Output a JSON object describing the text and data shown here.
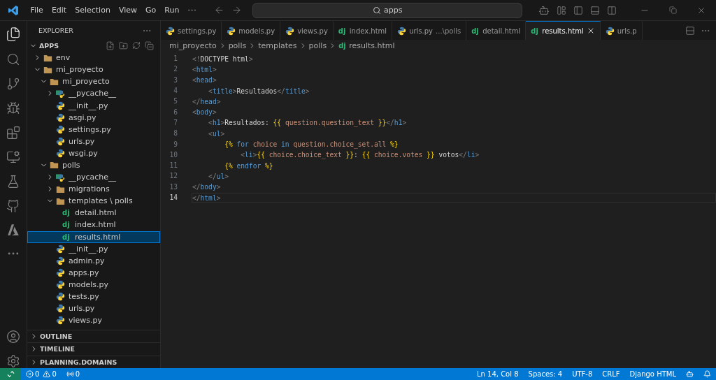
{
  "menu": [
    "File",
    "Edit",
    "Selection",
    "View",
    "Go",
    "Run"
  ],
  "search": {
    "value": "apps"
  },
  "explorer": {
    "title": "EXPLORER",
    "root": "APPS",
    "root_expanded": true,
    "tree": [
      {
        "name": "env",
        "kind": "folder",
        "expanded": false,
        "selected": false
      },
      {
        "name": "mi_proyecto",
        "kind": "folder",
        "expanded": true,
        "selected": false,
        "children": [
          {
            "name": "mi_proyecto",
            "kind": "folder",
            "expanded": true,
            "selected": false,
            "children": [
              {
                "name": "__pycache__",
                "kind": "pycache",
                "expanded": false,
                "selected": false
              },
              {
                "name": "__init__.py",
                "kind": "python",
                "selected": false
              },
              {
                "name": "asgi.py",
                "kind": "python",
                "selected": false
              },
              {
                "name": "settings.py",
                "kind": "python",
                "selected": false
              },
              {
                "name": "urls.py",
                "kind": "python",
                "selected": false
              },
              {
                "name": "wsgi.py",
                "kind": "python",
                "selected": false
              }
            ]
          },
          {
            "name": "polls",
            "kind": "folder",
            "expanded": true,
            "selected": false,
            "children": [
              {
                "name": "__pycache__",
                "kind": "pycache",
                "expanded": false,
                "selected": false
              },
              {
                "name": "migrations",
                "kind": "folder",
                "expanded": false,
                "selected": false
              },
              {
                "name": "templates \\ polls",
                "kind": "folder",
                "expanded": true,
                "selected": false,
                "children": [
                  {
                    "name": "detail.html",
                    "kind": "django",
                    "badge": "dj",
                    "selected": false
                  },
                  {
                    "name": "index.html",
                    "kind": "django",
                    "badge": "dj",
                    "selected": false
                  },
                  {
                    "name": "results.html",
                    "kind": "django",
                    "badge": "dj",
                    "selected": true
                  }
                ]
              },
              {
                "name": "__init__.py",
                "kind": "python",
                "selected": false
              },
              {
                "name": "admin.py",
                "kind": "python",
                "selected": false
              },
              {
                "name": "apps.py",
                "kind": "python",
                "selected": false
              },
              {
                "name": "models.py",
                "kind": "python",
                "selected": false
              },
              {
                "name": "tests.py",
                "kind": "python",
                "selected": false
              },
              {
                "name": "urls.py",
                "kind": "python",
                "selected": false
              },
              {
                "name": "views.py",
                "kind": "python",
                "selected": false
              }
            ]
          }
        ]
      }
    ],
    "sections": [
      {
        "title": "OUTLINE",
        "expanded": false
      },
      {
        "title": "TIMELINE",
        "expanded": false
      },
      {
        "title": "PLANNING.DOMAINS",
        "expanded": false
      }
    ]
  },
  "tabs": [
    {
      "label": "settings.py",
      "kind": "python",
      "selected": false
    },
    {
      "label": "models.py",
      "kind": "python",
      "selected": false
    },
    {
      "label": "views.py",
      "kind": "python",
      "selected": false
    },
    {
      "label": "index.html",
      "kind": "django",
      "badge": "dj",
      "selected": false
    },
    {
      "label": "urls.py",
      "description": "...\\polls",
      "kind": "python",
      "selected": false
    },
    {
      "label": "detail.html",
      "kind": "django",
      "badge": "dj",
      "selected": false
    },
    {
      "label": "results.html",
      "kind": "django",
      "badge": "dj",
      "selected": true
    },
    {
      "label": "urls.p",
      "kind": "python",
      "selected": false
    }
  ],
  "breadcrumb": [
    {
      "label": "mi_proyecto"
    },
    {
      "label": "polls"
    },
    {
      "label": "templates"
    },
    {
      "label": "polls"
    },
    {
      "label": "results.html",
      "badge": "dj"
    }
  ],
  "code": [
    {
      "number": "1",
      "current": false,
      "tokens": [
        {
          "kind": "p",
          "text": "<!"
        },
        {
          "kind": "t",
          "text": "DOCTYPE html"
        },
        {
          "kind": "p",
          "text": ">"
        }
      ]
    },
    {
      "number": "2",
      "current": false,
      "tokens": [
        {
          "kind": "p",
          "text": "<"
        },
        {
          "kind": "g",
          "text": "html"
        },
        {
          "kind": "p",
          "text": ">"
        }
      ]
    },
    {
      "number": "3",
      "current": false,
      "tokens": [
        {
          "kind": "p",
          "text": "<"
        },
        {
          "kind": "g",
          "text": "head"
        },
        {
          "kind": "p",
          "text": ">"
        }
      ]
    },
    {
      "number": "4",
      "current": false,
      "tokens": [
        {
          "kind": "p",
          "text": "    <"
        },
        {
          "kind": "g",
          "text": "title"
        },
        {
          "kind": "p",
          "text": ">"
        },
        {
          "kind": "t",
          "text": "Resultados"
        },
        {
          "kind": "p",
          "text": "</"
        },
        {
          "kind": "g",
          "text": "title"
        },
        {
          "kind": "p",
          "text": ">"
        }
      ]
    },
    {
      "number": "5",
      "current": false,
      "tokens": [
        {
          "kind": "p",
          "text": "</"
        },
        {
          "kind": "g",
          "text": "head"
        },
        {
          "kind": "p",
          "text": ">"
        }
      ]
    },
    {
      "number": "6",
      "current": false,
      "tokens": [
        {
          "kind": "p",
          "text": "<"
        },
        {
          "kind": "g",
          "text": "body"
        },
        {
          "kind": "p",
          "text": ">"
        }
      ]
    },
    {
      "number": "7",
      "current": false,
      "tokens": [
        {
          "kind": "p",
          "text": "    <"
        },
        {
          "kind": "g",
          "text": "h1"
        },
        {
          "kind": "p",
          "text": ">"
        },
        {
          "kind": "t",
          "text": "Resultados: "
        },
        {
          "kind": "b",
          "text": "{{"
        },
        {
          "kind": "v",
          "text": " question.question_text "
        },
        {
          "kind": "b",
          "text": "}}"
        },
        {
          "kind": "p",
          "text": "</"
        },
        {
          "kind": "g",
          "text": "h1"
        },
        {
          "kind": "p",
          "text": ">"
        }
      ]
    },
    {
      "number": "8",
      "current": false,
      "tokens": [
        {
          "kind": "p",
          "text": "    <"
        },
        {
          "kind": "g",
          "text": "ul"
        },
        {
          "kind": "p",
          "text": ">"
        }
      ]
    },
    {
      "number": "9",
      "current": false,
      "tokens": [
        {
          "kind": "b",
          "text": "        {%"
        },
        {
          "kind": "k",
          "text": " for"
        },
        {
          "kind": "v",
          "text": " choice"
        },
        {
          "kind": "k",
          "text": " in"
        },
        {
          "kind": "v",
          "text": " question.choice_set.all"
        },
        {
          "kind": "b",
          "text": " %}"
        }
      ]
    },
    {
      "number": "10",
      "current": false,
      "tokens": [
        {
          "kind": "p",
          "text": "            <"
        },
        {
          "kind": "g",
          "text": "li"
        },
        {
          "kind": "p",
          "text": ">"
        },
        {
          "kind": "b",
          "text": "{{"
        },
        {
          "kind": "v",
          "text": " choice.choice_text "
        },
        {
          "kind": "b",
          "text": "}}"
        },
        {
          "kind": "t",
          "text": ": "
        },
        {
          "kind": "b",
          "text": "{{"
        },
        {
          "kind": "v",
          "text": " choice.votes "
        },
        {
          "kind": "b",
          "text": "}}"
        },
        {
          "kind": "t",
          "text": " votos"
        },
        {
          "kind": "p",
          "text": "</"
        },
        {
          "kind": "g",
          "text": "li"
        },
        {
          "kind": "p",
          "text": ">"
        }
      ]
    },
    {
      "number": "11",
      "current": false,
      "tokens": [
        {
          "kind": "b",
          "text": "        {%"
        },
        {
          "kind": "k",
          "text": " endfor"
        },
        {
          "kind": "b",
          "text": " %}"
        }
      ]
    },
    {
      "number": "12",
      "current": false,
      "tokens": [
        {
          "kind": "p",
          "text": "    </"
        },
        {
          "kind": "g",
          "text": "ul"
        },
        {
          "kind": "p",
          "text": ">"
        }
      ]
    },
    {
      "number": "13",
      "current": false,
      "tokens": [
        {
          "kind": "p",
          "text": "</"
        },
        {
          "kind": "g",
          "text": "body"
        },
        {
          "kind": "p",
          "text": ">"
        }
      ]
    },
    {
      "number": "14",
      "current": true,
      "tokens": [
        {
          "kind": "p",
          "text": "</"
        },
        {
          "kind": "g",
          "text": "html"
        },
        {
          "kind": "p",
          "text": ">"
        }
      ]
    }
  ],
  "status_bar": {
    "errors": "0",
    "warnings": "0",
    "ports": "0",
    "items": [
      "Ln 14, Col 8",
      "Spaces: 4",
      "UTF-8",
      "CRLF",
      "Django HTML"
    ]
  }
}
